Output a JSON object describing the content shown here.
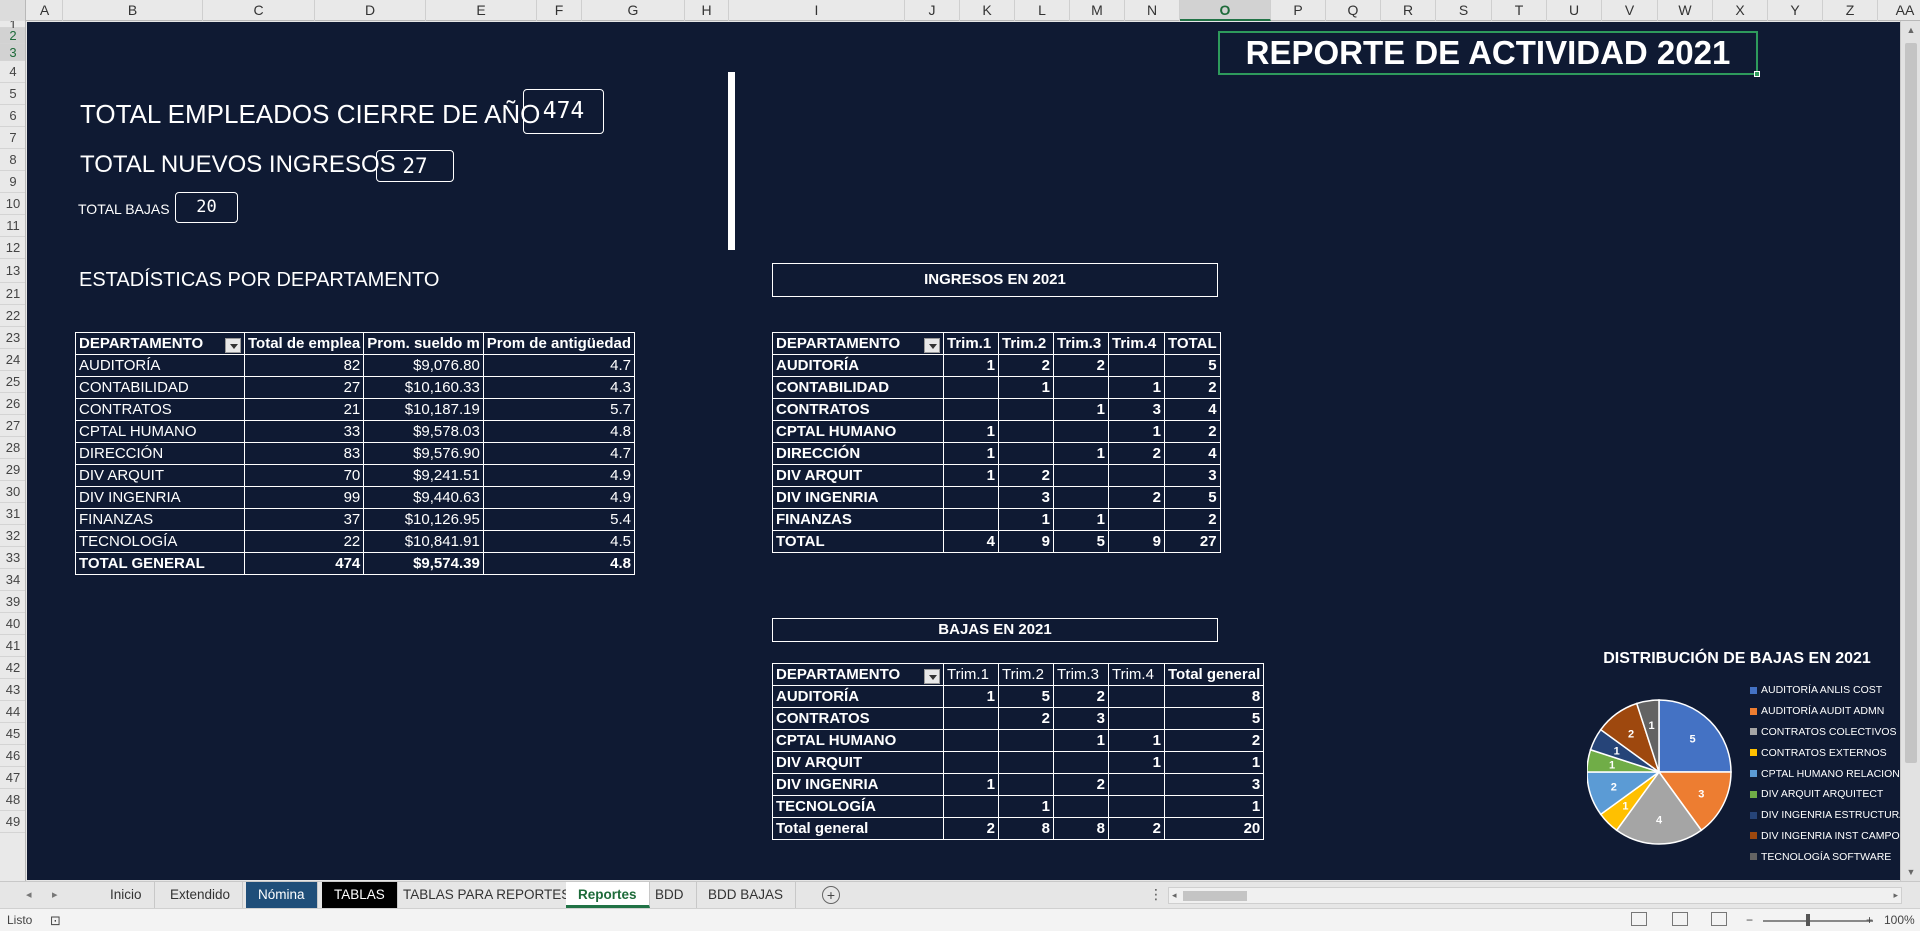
{
  "columns": [
    "A",
    "B",
    "C",
    "D",
    "E",
    "F",
    "G",
    "H",
    "I",
    "J",
    "K",
    "L",
    "M",
    "N",
    "O",
    "P",
    "Q",
    "R",
    "S",
    "T",
    "U",
    "V",
    "W",
    "X",
    "Y",
    "Z",
    "AA"
  ],
  "selected_column": "O",
  "rows": [
    "1",
    "2",
    "3",
    "4",
    "5",
    "6",
    "7",
    "8",
    "9",
    "10",
    "11",
    "12",
    "13",
    "21",
    "22",
    "23",
    "24",
    "25",
    "26",
    "27",
    "28",
    "29",
    "30",
    "31",
    "32",
    "33",
    "34",
    "39",
    "40",
    "41",
    "42",
    "43",
    "44",
    "45",
    "46",
    "47",
    "48",
    "49"
  ],
  "report_title": "REPORTE DE ACTIVIDAD 2021",
  "stats": {
    "total_empleados_label": "TOTAL EMPLEADOS CIERRE DE AÑO",
    "total_empleados_value": "474",
    "nuevos_ingresos_label": "TOTAL NUEVOS INGRESOS",
    "nuevos_ingresos_value": "27",
    "bajas_label": "TOTAL BAJAS",
    "bajas_value": "20"
  },
  "dept_section_title": "ESTADÍSTICAS POR DEPARTAMENTO",
  "dept_table": {
    "headers": [
      "DEPARTAMENTO",
      "Total de emplea",
      "Prom. sueldo m",
      "Prom de antigüedad"
    ],
    "rows": [
      [
        "AUDITORÍA",
        "82",
        "$9,076.80",
        "4.7"
      ],
      [
        "CONTABILIDAD",
        "27",
        "$10,160.33",
        "4.3"
      ],
      [
        "CONTRATOS",
        "21",
        "$10,187.19",
        "5.7"
      ],
      [
        "CPTAL HUMANO",
        "33",
        "$9,578.03",
        "4.8"
      ],
      [
        "DIRECCIÓN",
        "83",
        "$9,576.90",
        "4.7"
      ],
      [
        "DIV ARQUIT",
        "70",
        "$9,241.51",
        "4.9"
      ],
      [
        "DIV INGENRIA",
        "99",
        "$9,440.63",
        "4.9"
      ],
      [
        "FINANZAS",
        "37",
        "$10,126.95",
        "5.4"
      ],
      [
        "TECNOLOGÍA",
        "22",
        "$10,841.91",
        "4.5"
      ]
    ],
    "total": [
      "TOTAL GENERAL",
      "474",
      "$9,574.39",
      "4.8"
    ]
  },
  "ingresos": {
    "title": "INGRESOS EN 2021",
    "headers": [
      "DEPARTAMENTO",
      "Trim.1",
      "Trim.2",
      "Trim.3",
      "Trim.4",
      "TOTAL"
    ],
    "rows": [
      [
        "AUDITORÍA",
        "1",
        "2",
        "2",
        "",
        "5"
      ],
      [
        "CONTABILIDAD",
        "",
        "1",
        "",
        "1",
        "2"
      ],
      [
        "CONTRATOS",
        "",
        "",
        "1",
        "3",
        "4"
      ],
      [
        "CPTAL HUMANO",
        "1",
        "",
        "",
        "1",
        "2"
      ],
      [
        "DIRECCIÓN",
        "1",
        "",
        "1",
        "2",
        "4"
      ],
      [
        "DIV ARQUIT",
        "1",
        "2",
        "",
        "",
        "3"
      ],
      [
        "DIV INGENRIA",
        "",
        "3",
        "",
        "2",
        "5"
      ],
      [
        "FINANZAS",
        "",
        "1",
        "1",
        "",
        "2"
      ]
    ],
    "total": [
      "TOTAL",
      "4",
      "9",
      "5",
      "9",
      "27"
    ]
  },
  "bajas": {
    "title": "BAJAS EN 2021",
    "headers": [
      "DEPARTAMENTO",
      "Trim.1",
      "Trim.2",
      "Trim.3",
      "Trim.4",
      "Total general"
    ],
    "rows": [
      [
        "AUDITORÍA",
        "1",
        "5",
        "2",
        "",
        "8"
      ],
      [
        "CONTRATOS",
        "",
        "2",
        "3",
        "",
        "5"
      ],
      [
        "CPTAL HUMANO",
        "",
        "",
        "1",
        "1",
        "2"
      ],
      [
        "DIV ARQUIT",
        "",
        "",
        "",
        "1",
        "1"
      ],
      [
        "DIV INGENRIA",
        "1",
        "",
        "2",
        "",
        "3"
      ],
      [
        "TECNOLOGÍA",
        "",
        "1",
        "",
        "",
        "1"
      ]
    ],
    "total": [
      "Total general",
      "2",
      "8",
      "8",
      "2",
      "20"
    ]
  },
  "chart_data": {
    "type": "pie",
    "title": "DISTRIBUCIÓN DE BAJAS EN 2021",
    "categories": [
      "AUDITORÍA ANLIS COST",
      "AUDITORÍA AUDIT ADMN",
      "CONTRATOS COLECTIVOS",
      "CONTRATOS EXTERNOS",
      "CPTAL HUMANO RELACIONES",
      "DIV ARQUIT ARQUITECT",
      "DIV INGENRIA ESTRUCTURA",
      "DIV INGENRIA INST CAMPO",
      "TECNOLOGÍA SOFTWARE"
    ],
    "values": [
      5,
      3,
      4,
      1,
      2,
      1,
      1,
      2,
      1
    ],
    "colors": [
      "#4472c4",
      "#ed7d31",
      "#a5a5a5",
      "#ffc000",
      "#5b9bd5",
      "#70ad47",
      "#264478",
      "#9e480e",
      "#636363"
    ],
    "data_labels": true,
    "legend": "right"
  },
  "sheet_tabs": [
    "Inicio",
    "Extendido",
    "Nómina",
    "TABLAS",
    "TABLAS PARA REPORTES",
    "Reportes",
    "BDD",
    "BDD BAJAS"
  ],
  "active_tab": "Reportes",
  "status": {
    "ready": "Listo",
    "zoom": "100%"
  },
  "icons": {
    "add_sheet": "plus-circle-icon",
    "accessibility": "accessibility-icon"
  }
}
